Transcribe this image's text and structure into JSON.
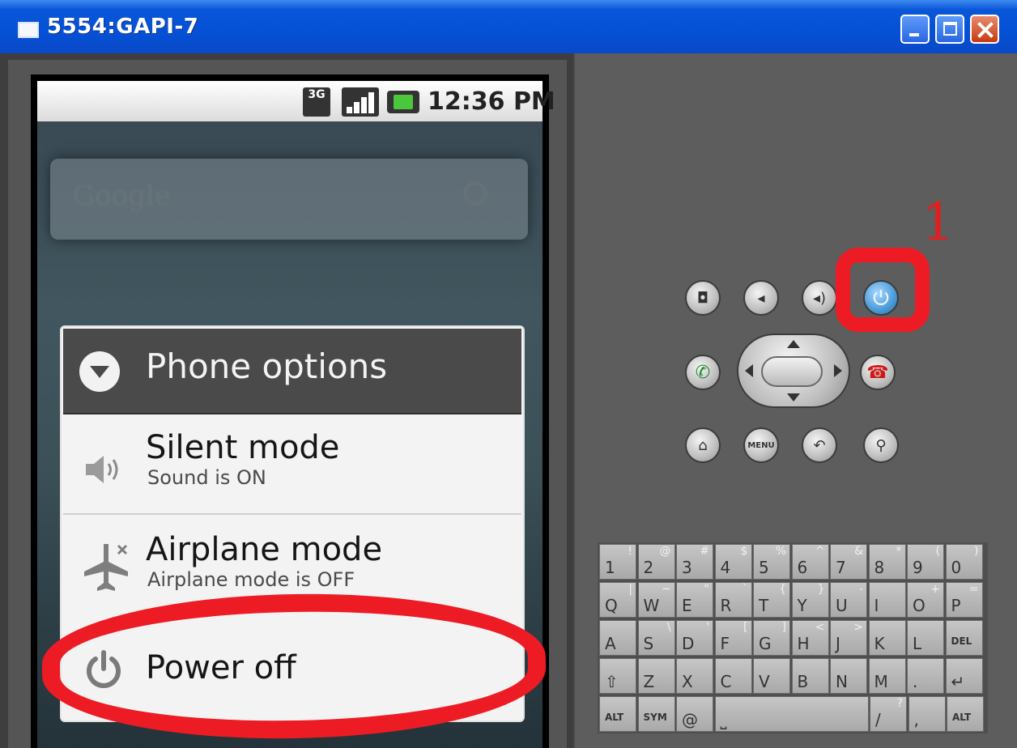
{
  "window": {
    "title": "5554:GAPI-7"
  },
  "statusbar": {
    "network": "3G",
    "time": "12:36 PM"
  },
  "home": {
    "search_placeholder": "Google"
  },
  "dialog": {
    "title": "Phone options",
    "items": [
      {
        "title": "Silent mode",
        "subtitle": "Sound is ON",
        "icon": "speaker-icon"
      },
      {
        "title": "Airplane mode",
        "subtitle": "Airplane mode is OFF",
        "icon": "airplane-icon"
      },
      {
        "title": "Power off",
        "icon": "power-icon"
      }
    ]
  },
  "annotations": {
    "step_number": "1",
    "highlight_color": "#ed1c24"
  },
  "controls": {
    "row1": [
      "camera-icon",
      "volume-down-icon",
      "volume-up-icon",
      "power-icon"
    ],
    "row2": [
      "call-icon",
      "dpad",
      "end-call-icon"
    ],
    "row3": [
      "home-icon",
      "menu-button",
      "back-icon",
      "search-icon"
    ],
    "menu_label": "MENU"
  },
  "keyboard": {
    "rows": [
      [
        [
          "1",
          "!"
        ],
        [
          "2",
          "@"
        ],
        [
          "3",
          "#"
        ],
        [
          "4",
          "$"
        ],
        [
          "5",
          "%"
        ],
        [
          "6",
          "^"
        ],
        [
          "7",
          "&"
        ],
        [
          "8",
          "*"
        ],
        [
          "9",
          "("
        ],
        [
          "0",
          ")"
        ]
      ],
      [
        [
          "Q",
          "|"
        ],
        [
          "W",
          "~"
        ],
        [
          "E",
          "\""
        ],
        [
          "R",
          "`"
        ],
        [
          "T",
          "{"
        ],
        [
          "Y",
          "}"
        ],
        [
          "U",
          "-"
        ],
        [
          "I",
          ""
        ],
        [
          "O",
          "+"
        ],
        [
          "P",
          "="
        ]
      ],
      [
        [
          "A",
          ""
        ],
        [
          "S",
          "\\"
        ],
        [
          "D",
          "'"
        ],
        [
          "F",
          "["
        ],
        [
          "G",
          "]"
        ],
        [
          "H",
          "<"
        ],
        [
          "J",
          ">"
        ],
        [
          "K",
          ""
        ],
        [
          "L",
          ""
        ],
        [
          "DEL",
          ""
        ]
      ],
      [
        [
          "⇧",
          ""
        ],
        [
          "Z",
          ""
        ],
        [
          "X",
          ""
        ],
        [
          "C",
          ""
        ],
        [
          "V",
          ""
        ],
        [
          "B",
          ""
        ],
        [
          "N",
          ""
        ],
        [
          "M",
          ""
        ],
        [
          ".",
          ""
        ],
        [
          "↵",
          ""
        ]
      ],
      [
        [
          "ALT",
          ""
        ],
        [
          "SYM",
          ""
        ],
        [
          "@",
          ""
        ],
        [
          "␣",
          ""
        ],
        [
          "/",
          "?"
        ],
        [
          ",",
          ""
        ],
        [
          "ALT",
          ""
        ]
      ]
    ]
  }
}
